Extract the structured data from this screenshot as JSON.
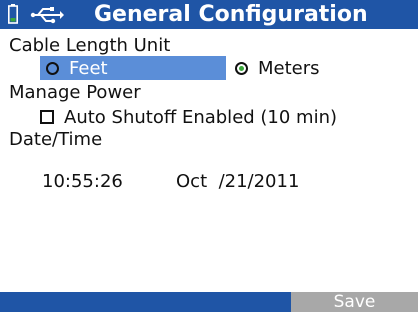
{
  "header": {
    "title": "General Configuration",
    "battery_icon": "battery-icon",
    "usb_icon": "usb-icon",
    "background": "#1f55a6"
  },
  "cable_length": {
    "label": "Cable Length Unit",
    "options": [
      {
        "label": "Feet",
        "selected": false,
        "highlighted": true
      },
      {
        "label": "Meters",
        "selected": true,
        "highlighted": false
      }
    ],
    "highlight_color": "#5b8ed8",
    "selected_dot_color": "#3aa73a"
  },
  "power": {
    "label": "Manage Power",
    "auto_shutoff": {
      "label": "Auto Shutoff Enabled (10 min)",
      "checked": false
    }
  },
  "datetime": {
    "label": "Date/Time",
    "time": "10:55:26",
    "date": "Oct  /21/2011"
  },
  "footer": {
    "save_label": "Save",
    "save_button_color": "#a8a8a8"
  }
}
